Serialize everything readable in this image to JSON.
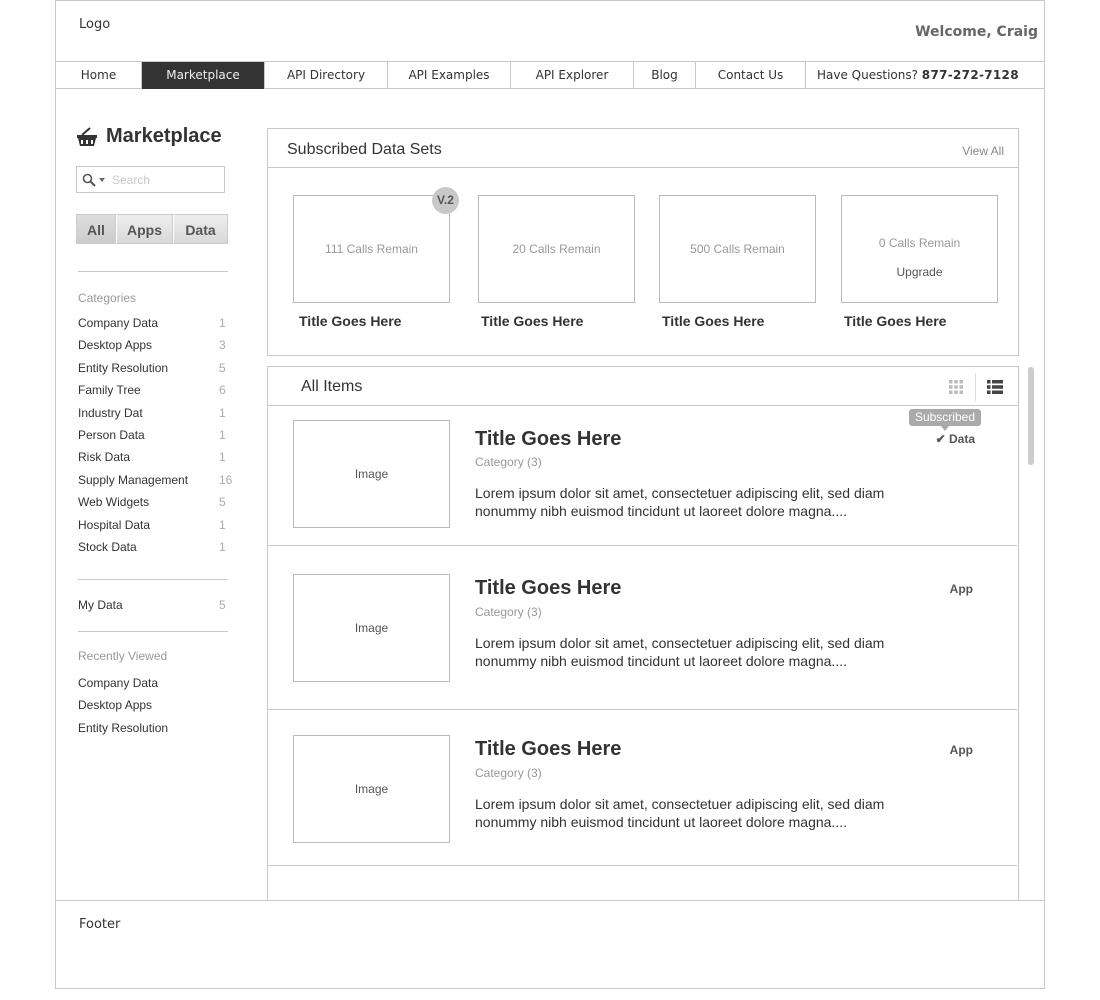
{
  "header": {
    "logo": "Logo",
    "welcome": "Welcome, Craig"
  },
  "nav": {
    "items": [
      {
        "label": "Home",
        "active": false
      },
      {
        "label": "Marketplace",
        "active": true
      },
      {
        "label": "API Directory",
        "active": false
      },
      {
        "label": "API Examples",
        "active": false
      },
      {
        "label": "API Explorer",
        "active": false
      },
      {
        "label": "Blog",
        "active": false
      },
      {
        "label": "Contact Us",
        "active": false
      }
    ],
    "questions_label": "Have Questions?",
    "phone": "877-272-7128"
  },
  "sidebar": {
    "title": "Marketplace",
    "title_icon": "basket-icon",
    "search": {
      "placeholder": "Search",
      "value": ""
    },
    "filters": [
      {
        "label": "All",
        "active": true
      },
      {
        "label": "Apps",
        "active": false
      },
      {
        "label": "Data",
        "active": false
      }
    ],
    "categories_heading": "Categories",
    "categories": [
      {
        "name": "Company Data",
        "count": "1"
      },
      {
        "name": "Desktop Apps",
        "count": "3"
      },
      {
        "name": "Entity Resolution",
        "count": "5"
      },
      {
        "name": "Family Tree",
        "count": "6"
      },
      {
        "name": "Industry Dat",
        "count": "1"
      },
      {
        "name": "Person Data",
        "count": "1"
      },
      {
        "name": "Risk Data",
        "count": "1"
      },
      {
        "name": "Supply Management",
        "count": "16"
      },
      {
        "name": "Web Widgets",
        "count": "5"
      },
      {
        "name": "Hospital Data",
        "count": "1"
      },
      {
        "name": "Stock Data",
        "count": "1"
      }
    ],
    "my_data": {
      "label": "My Data",
      "count": "5"
    },
    "recent_heading": "Recently Viewed",
    "recent": [
      "Company Data",
      "Desktop Apps",
      "Entity Resolution"
    ]
  },
  "subscribed": {
    "title": "Subscribed Data Sets",
    "view_all": "View All",
    "cards": [
      {
        "calls": "111 Calls Remain",
        "title": "Title Goes Here",
        "badge": "V.2"
      },
      {
        "calls": "20 Calls Remain",
        "title": "Title Goes Here"
      },
      {
        "calls": "500 Calls Remain",
        "title": "Title Goes Here"
      },
      {
        "calls": "0 Calls Remain",
        "title": "Title Goes Here",
        "action": "Upgrade"
      }
    ]
  },
  "all_items": {
    "title": "All Items",
    "view_icons": [
      "grid-view-icon",
      "list-view-icon"
    ],
    "items": [
      {
        "image": "Image",
        "title": "Title Goes Here",
        "category": "Category (3)",
        "description": "Lorem ipsum dolor sit amet, consectetuer adipiscing elit, sed diam nonummy nibh euismod tincidunt ut laoreet dolore magna....",
        "type": "Data",
        "subscribed": "Subscribed"
      },
      {
        "image": "Image",
        "title": "Title Goes Here",
        "category": "Category (3)",
        "description": "Lorem ipsum dolor sit amet, consectetuer adipiscing elit, sed diam nonummy nibh euismod tincidunt ut laoreet dolore magna....",
        "type": "App"
      },
      {
        "image": "Image",
        "title": "Title Goes Here",
        "category": "Category (3)",
        "description": "Lorem ipsum dolor sit amet, consectetuer adipiscing elit, sed diam nonummy nibh euismod tincidunt ut laoreet dolore magna....",
        "type": "App"
      }
    ]
  },
  "footer": {
    "label": "Footer"
  }
}
